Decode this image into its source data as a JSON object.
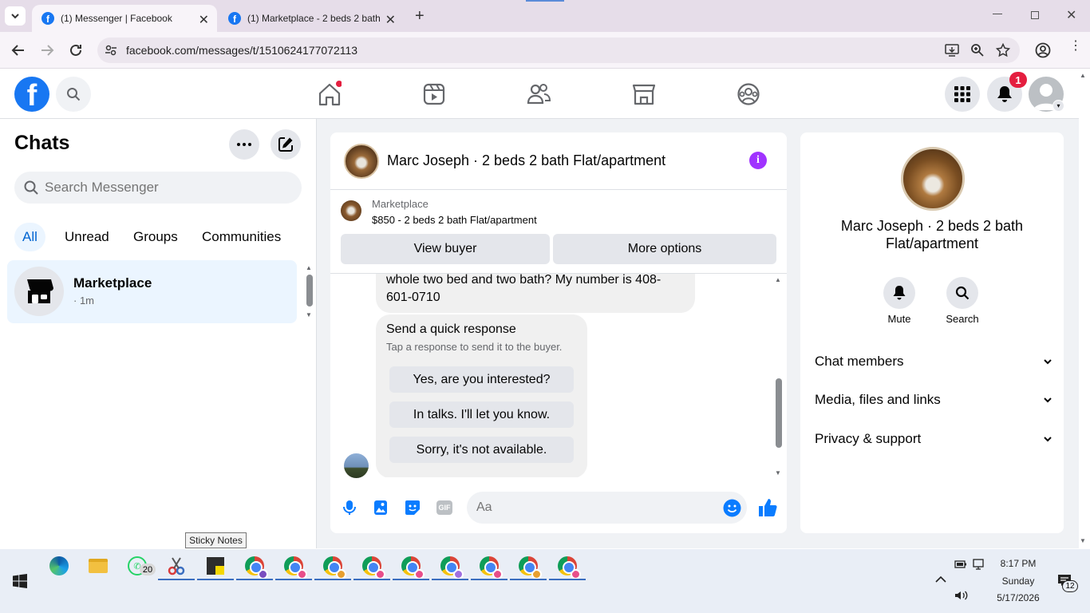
{
  "browser": {
    "tabs": [
      {
        "title": "(1) Messenger | Facebook",
        "active": true
      },
      {
        "title": "(1) Marketplace - 2 beds 2 bath",
        "active": false
      }
    ],
    "url": "facebook.com/messages/t/1510624177072113"
  },
  "fb_header": {
    "notification_count": "1",
    "nav_icons": [
      "home-icon",
      "reels-icon",
      "friends-icon",
      "marketplace-icon",
      "groups-icon"
    ]
  },
  "chats": {
    "title": "Chats",
    "search_placeholder": "Search Messenger",
    "filters": [
      "All",
      "Unread",
      "Groups",
      "Communities"
    ],
    "active_filter": "All",
    "items": [
      {
        "name": "Marketplace",
        "meta": "· 1m"
      }
    ]
  },
  "conversation": {
    "title": "Marc Joseph · 2 beds 2 bath Flat/apartment",
    "listing": {
      "source": "Marketplace",
      "summary": "$850 - 2 beds 2 bath Flat/apartment"
    },
    "buttons": {
      "view_buyer": "View buyer",
      "more_options": "More options"
    },
    "messages": {
      "partial_text": "whole two bed and two bath? My number is 408-601-0710"
    },
    "quick_response": {
      "title": "Send a quick response",
      "subtitle": "Tap a response to send it to the buyer.",
      "options": [
        "Yes, are you interested?",
        "In talks. I'll let you know.",
        "Sorry, it's not available."
      ]
    },
    "composer": {
      "placeholder": "Aa"
    }
  },
  "details_panel": {
    "name": "Marc Joseph · 2 beds 2 bath Flat/apartment",
    "actions": [
      {
        "label": "Mute",
        "icon": "bell-icon"
      },
      {
        "label": "Search",
        "icon": "search-icon"
      }
    ],
    "sections": [
      "Chat members",
      "Media, files and links",
      "Privacy & support"
    ]
  },
  "tooltip": "Sticky Notes",
  "taskbar": {
    "whatsapp_badge": "20",
    "time": "8:17 PM",
    "day": "Sunday",
    "date": "5/17/2026",
    "notification_count": "12"
  },
  "colors": {
    "fb_blue": "#1877f2",
    "purple": "#a033ff",
    "selected_chat_bg": "#ebf5ff"
  }
}
